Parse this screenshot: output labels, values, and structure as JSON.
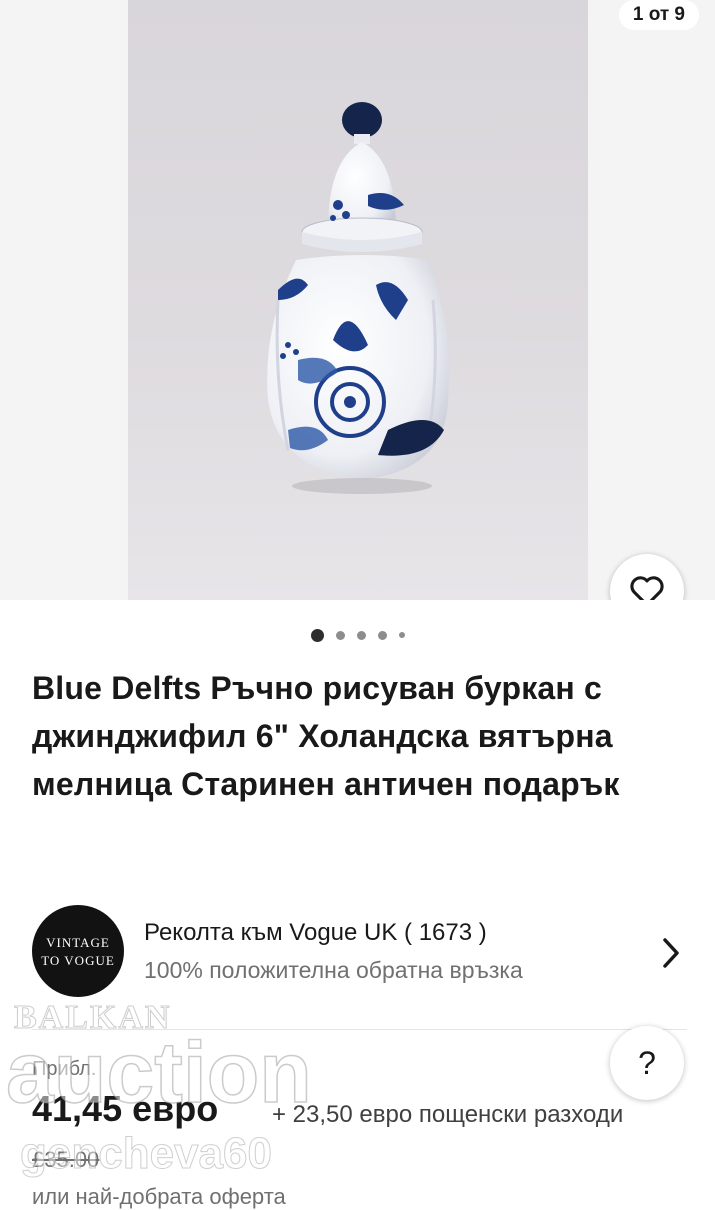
{
  "gallery": {
    "counter": "1 от 9",
    "dots_count": 5,
    "active_dot": 1
  },
  "listing": {
    "title": "Blue Delfts Ръчно рисуван буркан с джинджифил 6\" Холандска вятърна мелница Старинен античен подарък"
  },
  "seller": {
    "avatar_line1": "VINTAGE",
    "avatar_line2": "TO VOGUE",
    "name": "Реколта към Vogue UK ( 1673 )",
    "feedback": "100% положителна обратна връзка"
  },
  "pricing": {
    "approx_label": "Прибл.",
    "price": "41,45 евро",
    "shipping": "+ 23,50 евро пощенски разходи",
    "original_price": "£35.00",
    "best_offer": "или най-добрата оферта"
  },
  "watermark": {
    "line1": "BALKAN",
    "line2": "auction",
    "line3": "genchevа60"
  },
  "help": {
    "label": "?"
  },
  "colors": {
    "text": "#191919",
    "secondary": "#707070",
    "photo_bg": "#dcd9dd",
    "delft_blue": "#1f3f8a"
  },
  "icons": [
    "heart-icon",
    "chevron-right-icon",
    "question-icon"
  ]
}
